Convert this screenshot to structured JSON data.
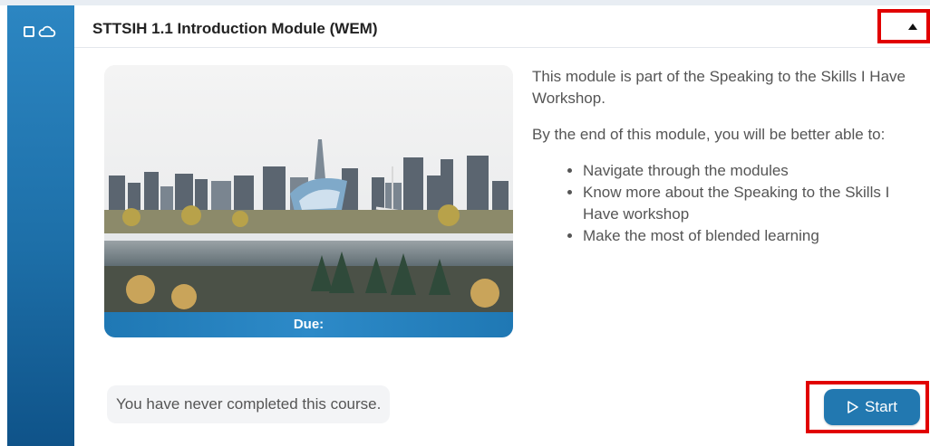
{
  "module": {
    "title": "STTSIH 1.1 Introduction Module (WEM)",
    "due_label": "Due:",
    "description": {
      "intro": "This module is part of the Speaking to the Skills I Have Workshop.",
      "lead": "By the end of this module, you will be better able to:",
      "bullets": [
        "Navigate through the modules",
        "Know more about the Speaking to the Skills I Have workshop",
        "Make the most of blended learning"
      ]
    },
    "status": "You have never completed this course.",
    "start_label": "Start"
  },
  "icons": {
    "sidebar": [
      "square-icon",
      "cloud-icon"
    ],
    "collapse": "triangle-up-icon",
    "start": "play-outline-icon"
  },
  "colors": {
    "accent": "#2278b0",
    "highlight": "#e10000"
  }
}
